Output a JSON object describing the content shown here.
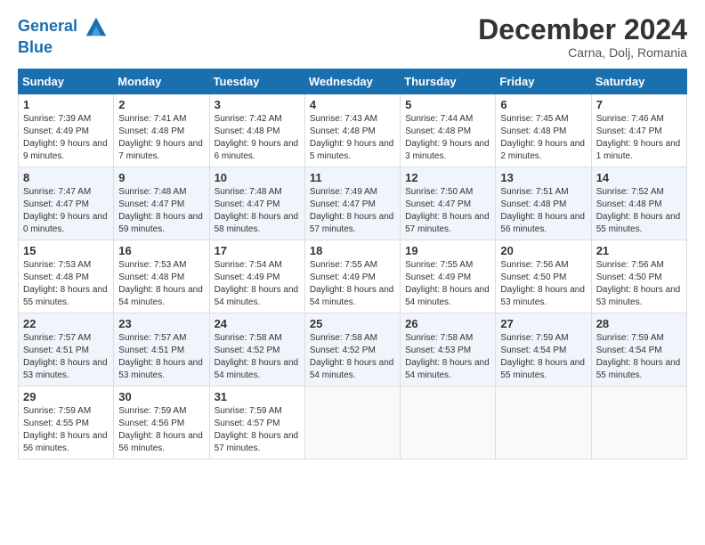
{
  "header": {
    "logo_line1": "General",
    "logo_line2": "Blue",
    "month_title": "December 2024",
    "location": "Carna, Dolj, Romania"
  },
  "weekdays": [
    "Sunday",
    "Monday",
    "Tuesday",
    "Wednesday",
    "Thursday",
    "Friday",
    "Saturday"
  ],
  "weeks": [
    [
      {
        "day": "1",
        "sunrise": "Sunrise: 7:39 AM",
        "sunset": "Sunset: 4:49 PM",
        "daylight": "Daylight: 9 hours and 9 minutes."
      },
      {
        "day": "2",
        "sunrise": "Sunrise: 7:41 AM",
        "sunset": "Sunset: 4:48 PM",
        "daylight": "Daylight: 9 hours and 7 minutes."
      },
      {
        "day": "3",
        "sunrise": "Sunrise: 7:42 AM",
        "sunset": "Sunset: 4:48 PM",
        "daylight": "Daylight: 9 hours and 6 minutes."
      },
      {
        "day": "4",
        "sunrise": "Sunrise: 7:43 AM",
        "sunset": "Sunset: 4:48 PM",
        "daylight": "Daylight: 9 hours and 5 minutes."
      },
      {
        "day": "5",
        "sunrise": "Sunrise: 7:44 AM",
        "sunset": "Sunset: 4:48 PM",
        "daylight": "Daylight: 9 hours and 3 minutes."
      },
      {
        "day": "6",
        "sunrise": "Sunrise: 7:45 AM",
        "sunset": "Sunset: 4:48 PM",
        "daylight": "Daylight: 9 hours and 2 minutes."
      },
      {
        "day": "7",
        "sunrise": "Sunrise: 7:46 AM",
        "sunset": "Sunset: 4:47 PM",
        "daylight": "Daylight: 9 hours and 1 minute."
      }
    ],
    [
      {
        "day": "8",
        "sunrise": "Sunrise: 7:47 AM",
        "sunset": "Sunset: 4:47 PM",
        "daylight": "Daylight: 9 hours and 0 minutes."
      },
      {
        "day": "9",
        "sunrise": "Sunrise: 7:48 AM",
        "sunset": "Sunset: 4:47 PM",
        "daylight": "Daylight: 8 hours and 59 minutes."
      },
      {
        "day": "10",
        "sunrise": "Sunrise: 7:48 AM",
        "sunset": "Sunset: 4:47 PM",
        "daylight": "Daylight: 8 hours and 58 minutes."
      },
      {
        "day": "11",
        "sunrise": "Sunrise: 7:49 AM",
        "sunset": "Sunset: 4:47 PM",
        "daylight": "Daylight: 8 hours and 57 minutes."
      },
      {
        "day": "12",
        "sunrise": "Sunrise: 7:50 AM",
        "sunset": "Sunset: 4:47 PM",
        "daylight": "Daylight: 8 hours and 57 minutes."
      },
      {
        "day": "13",
        "sunrise": "Sunrise: 7:51 AM",
        "sunset": "Sunset: 4:48 PM",
        "daylight": "Daylight: 8 hours and 56 minutes."
      },
      {
        "day": "14",
        "sunrise": "Sunrise: 7:52 AM",
        "sunset": "Sunset: 4:48 PM",
        "daylight": "Daylight: 8 hours and 55 minutes."
      }
    ],
    [
      {
        "day": "15",
        "sunrise": "Sunrise: 7:53 AM",
        "sunset": "Sunset: 4:48 PM",
        "daylight": "Daylight: 8 hours and 55 minutes."
      },
      {
        "day": "16",
        "sunrise": "Sunrise: 7:53 AM",
        "sunset": "Sunset: 4:48 PM",
        "daylight": "Daylight: 8 hours and 54 minutes."
      },
      {
        "day": "17",
        "sunrise": "Sunrise: 7:54 AM",
        "sunset": "Sunset: 4:49 PM",
        "daylight": "Daylight: 8 hours and 54 minutes."
      },
      {
        "day": "18",
        "sunrise": "Sunrise: 7:55 AM",
        "sunset": "Sunset: 4:49 PM",
        "daylight": "Daylight: 8 hours and 54 minutes."
      },
      {
        "day": "19",
        "sunrise": "Sunrise: 7:55 AM",
        "sunset": "Sunset: 4:49 PM",
        "daylight": "Daylight: 8 hours and 54 minutes."
      },
      {
        "day": "20",
        "sunrise": "Sunrise: 7:56 AM",
        "sunset": "Sunset: 4:50 PM",
        "daylight": "Daylight: 8 hours and 53 minutes."
      },
      {
        "day": "21",
        "sunrise": "Sunrise: 7:56 AM",
        "sunset": "Sunset: 4:50 PM",
        "daylight": "Daylight: 8 hours and 53 minutes."
      }
    ],
    [
      {
        "day": "22",
        "sunrise": "Sunrise: 7:57 AM",
        "sunset": "Sunset: 4:51 PM",
        "daylight": "Daylight: 8 hours and 53 minutes."
      },
      {
        "day": "23",
        "sunrise": "Sunrise: 7:57 AM",
        "sunset": "Sunset: 4:51 PM",
        "daylight": "Daylight: 8 hours and 53 minutes."
      },
      {
        "day": "24",
        "sunrise": "Sunrise: 7:58 AM",
        "sunset": "Sunset: 4:52 PM",
        "daylight": "Daylight: 8 hours and 54 minutes."
      },
      {
        "day": "25",
        "sunrise": "Sunrise: 7:58 AM",
        "sunset": "Sunset: 4:52 PM",
        "daylight": "Daylight: 8 hours and 54 minutes."
      },
      {
        "day": "26",
        "sunrise": "Sunrise: 7:58 AM",
        "sunset": "Sunset: 4:53 PM",
        "daylight": "Daylight: 8 hours and 54 minutes."
      },
      {
        "day": "27",
        "sunrise": "Sunrise: 7:59 AM",
        "sunset": "Sunset: 4:54 PM",
        "daylight": "Daylight: 8 hours and 55 minutes."
      },
      {
        "day": "28",
        "sunrise": "Sunrise: 7:59 AM",
        "sunset": "Sunset: 4:54 PM",
        "daylight": "Daylight: 8 hours and 55 minutes."
      }
    ],
    [
      {
        "day": "29",
        "sunrise": "Sunrise: 7:59 AM",
        "sunset": "Sunset: 4:55 PM",
        "daylight": "Daylight: 8 hours and 56 minutes."
      },
      {
        "day": "30",
        "sunrise": "Sunrise: 7:59 AM",
        "sunset": "Sunset: 4:56 PM",
        "daylight": "Daylight: 8 hours and 56 minutes."
      },
      {
        "day": "31",
        "sunrise": "Sunrise: 7:59 AM",
        "sunset": "Sunset: 4:57 PM",
        "daylight": "Daylight: 8 hours and 57 minutes."
      },
      null,
      null,
      null,
      null
    ]
  ]
}
